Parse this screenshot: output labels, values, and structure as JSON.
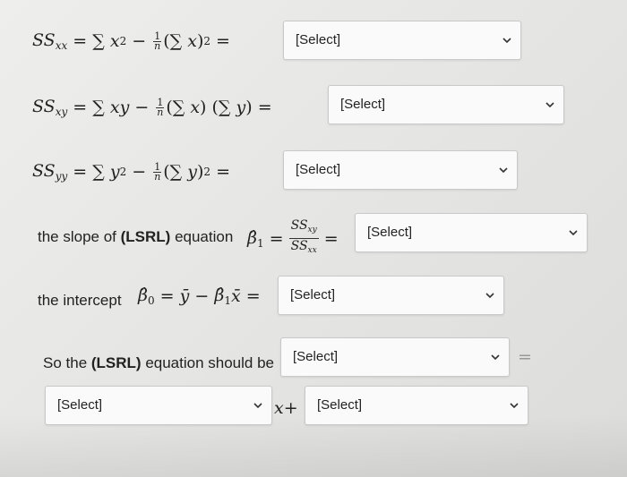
{
  "placeholder": "[Select]",
  "rows": {
    "ssxx": {
      "lhs_sub": "xx"
    },
    "ssxy": {
      "lhs_sub": "xy"
    },
    "ssyy": {
      "lhs_sub": "yy"
    }
  },
  "slope": {
    "prefix": "the slope of ",
    "bold": "(LSRL)",
    "suffix": " equation"
  },
  "intercept": {
    "prefix": "the intercept"
  },
  "final": {
    "text_prefix": "So the ",
    "bold": "(LSRL)",
    "text_suffix": " equation should be"
  },
  "selects": {
    "ssxx": "[Select]",
    "ssxy": "[Select]",
    "ssyy": "[Select]",
    "slope": "[Select]",
    "intercept": "[Select]",
    "final_top": "[Select]",
    "final_a": "[Select]",
    "final_b": "[Select]"
  }
}
